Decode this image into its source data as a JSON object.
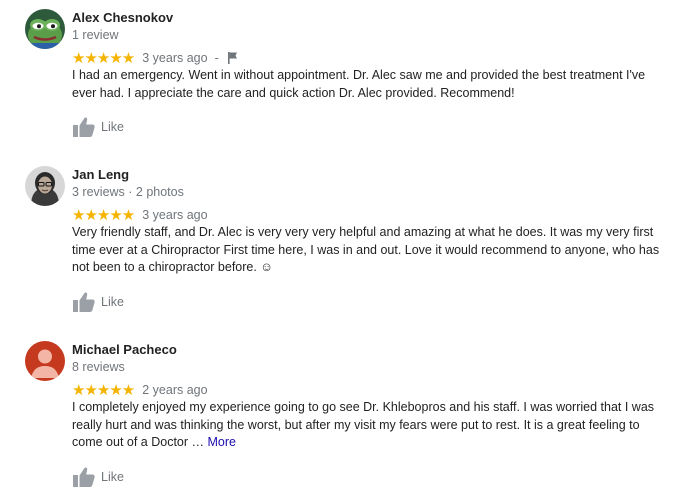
{
  "reviews": [
    {
      "name": "Alex Chesnokov",
      "meta": "1 review",
      "stars": "★★★★★",
      "age": "3 years ago",
      "dash": "-",
      "text": "I had an emergency. Went in without appointment. Dr. Alec saw me and provided the best treatment I've ever had. I appreciate the care and quick action Dr. Alec provided. Recommend!",
      "like_label": "Like",
      "avatar": "frog-avatar-icon"
    },
    {
      "name": "Jan Leng",
      "meta": "3 reviews · 2 photos",
      "stars": "★★★★★",
      "age": "3 years ago",
      "text": "Very friendly staff, and Dr. Alec is very very very helpful and amazing at what he does. It was my very first time ever at a Chiropractor First time here, I was in and out. Love it would recommend to anyone, who has not been to a chiropractor before. ☺",
      "like_label": "Like",
      "avatar": "photo-avatar"
    },
    {
      "name": "Michael Pacheco",
      "meta": "8 reviews",
      "stars": "★★★★★",
      "age": "2 years ago",
      "text": "I completely enjoyed my experience going to go see Dr. Khlebopros and his staff. I was worried that I was really hurt and was thinking the worst, but after my visit my fears were put to rest. It is a great feeling to come out of a Doctor …",
      "more_label": "More",
      "like_label": "Like",
      "avatar": "person-silhouette-icon"
    }
  ],
  "colors": {
    "star": "#f4b400",
    "secondary_text": "#70757a",
    "link": "#1a0dab",
    "avatar_red": "#c5391f"
  }
}
